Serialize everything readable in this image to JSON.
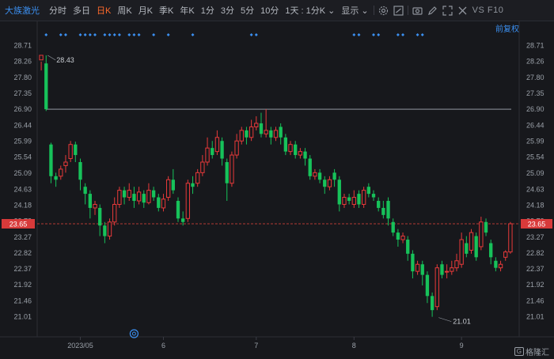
{
  "toolbar": {
    "stock_name": "大族激光",
    "tabs": [
      "分时",
      "多日",
      "日K",
      "周K",
      "月K",
      "季K",
      "年K",
      "1分",
      "3分",
      "5分",
      "10分",
      "1天 : 1分K ⌄",
      "显示 ⌄"
    ],
    "active_tab": "日K",
    "vs_f10": "VS F10",
    "icons": [
      "gear-icon",
      "compare-icon",
      "camera-icon",
      "edit-icon",
      "expand-icon",
      "close-icon"
    ]
  },
  "adjust_label": "前复权",
  "colors": {
    "up": "#e83a3a",
    "down": "#17c25a",
    "price_line": "#e8463c",
    "accent": "#3b8ff0",
    "price_tag_bg": "#d83a3a"
  },
  "chart_data": {
    "type": "candlestick",
    "ylim": [
      20.8,
      28.9
    ],
    "y_ticks": [
      "28.71",
      "28.26",
      "27.80",
      "27.35",
      "26.90",
      "26.44",
      "25.99",
      "25.54",
      "25.09",
      "24.63",
      "24.18",
      "23.73",
      "23.27",
      "22.82",
      "22.37",
      "21.92",
      "21.46",
      "21.01"
    ],
    "current_price": "23.65",
    "hline_value": 26.9,
    "x_labels": [
      {
        "index": 8,
        "label": "2023/05"
      },
      {
        "index": 25,
        "label": "6"
      },
      {
        "index": 44,
        "label": "7"
      },
      {
        "index": 64,
        "label": "8"
      },
      {
        "index": 86,
        "label": "9"
      }
    ],
    "annotations": [
      {
        "index": 1,
        "value": 28.43,
        "label": "28.43"
      },
      {
        "index": 81,
        "value": 21.01,
        "label": "21.01"
      }
    ],
    "dividend_markers": [
      1,
      4,
      5,
      8,
      9,
      10,
      11,
      13,
      14,
      15,
      16,
      18,
      19,
      20,
      23,
      26,
      31,
      43,
      44,
      64,
      65,
      68,
      69,
      73,
      74,
      77,
      78
    ],
    "event_marker_index": 19,
    "candles": [
      [
        28.3,
        28.43,
        28.25,
        28.0
      ],
      [
        28.2,
        26.9,
        28.43,
        26.85
      ],
      [
        25.9,
        25.0,
        25.95,
        24.8
      ],
      [
        25.0,
        24.9,
        25.1,
        24.7
      ],
      [
        25.0,
        25.2,
        25.3,
        24.9
      ],
      [
        25.3,
        25.4,
        25.6,
        25.1
      ],
      [
        25.5,
        25.9,
        26.0,
        25.4
      ],
      [
        25.9,
        25.6,
        25.98,
        25.4
      ],
      [
        25.4,
        24.9,
        25.5,
        24.6
      ],
      [
        24.7,
        24.5,
        24.8,
        24.2
      ],
      [
        24.5,
        24.1,
        24.6,
        23.8
      ],
      [
        24.1,
        24.2,
        24.3,
        23.9
      ],
      [
        24.1,
        23.6,
        24.2,
        23.3
      ],
      [
        23.6,
        23.3,
        23.7,
        23.1
      ],
      [
        23.3,
        23.7,
        23.8,
        23.2
      ],
      [
        23.7,
        24.2,
        24.4,
        23.6
      ],
      [
        24.2,
        24.6,
        24.7,
        24.1
      ],
      [
        24.6,
        24.4,
        24.7,
        24.2
      ],
      [
        24.4,
        24.6,
        24.8,
        24.3
      ],
      [
        24.5,
        24.3,
        24.7,
        24.1
      ],
      [
        24.3,
        24.55,
        24.7,
        24.2
      ],
      [
        24.5,
        24.25,
        24.6,
        24.1
      ],
      [
        24.25,
        24.6,
        24.8,
        24.2
      ],
      [
        24.6,
        24.4,
        24.7,
        24.3
      ],
      [
        24.4,
        24.1,
        24.5,
        24.0
      ],
      [
        24.1,
        24.35,
        24.5,
        24.0
      ],
      [
        24.4,
        24.9,
        25.0,
        24.3
      ],
      [
        24.9,
        24.6,
        25.2,
        24.5
      ],
      [
        24.3,
        23.8,
        24.4,
        23.7
      ],
      [
        23.8,
        23.7,
        24.0,
        23.6
      ],
      [
        23.8,
        24.8,
        24.9,
        23.7
      ],
      [
        24.8,
        24.7,
        25.0,
        24.5
      ],
      [
        24.8,
        25.1,
        25.2,
        24.7
      ],
      [
        25.1,
        25.4,
        25.6,
        25.0
      ],
      [
        25.4,
        25.8,
        26.1,
        25.3
      ],
      [
        25.8,
        25.6,
        26.0,
        25.5
      ],
      [
        25.7,
        26.1,
        26.3,
        25.6
      ],
      [
        26.0,
        25.5,
        26.1,
        25.3
      ],
      [
        25.4,
        24.8,
        25.5,
        24.3
      ],
      [
        24.8,
        25.6,
        25.7,
        24.7
      ],
      [
        25.6,
        26.0,
        26.2,
        25.5
      ],
      [
        26.0,
        26.3,
        26.4,
        25.9
      ],
      [
        26.3,
        26.1,
        26.4,
        25.9
      ],
      [
        26.1,
        26.4,
        26.6,
        26.0
      ],
      [
        26.4,
        26.5,
        26.7,
        26.3
      ],
      [
        26.5,
        26.2,
        26.8,
        26.1
      ],
      [
        26.2,
        26.3,
        26.9,
        26.1
      ],
      [
        26.3,
        26.1,
        26.4,
        25.9
      ],
      [
        26.1,
        26.3,
        26.4,
        26.0
      ],
      [
        26.4,
        26.1,
        26.5,
        25.9
      ],
      [
        26.1,
        25.7,
        26.2,
        25.6
      ],
      [
        25.7,
        25.9,
        26.0,
        25.6
      ],
      [
        25.9,
        25.6,
        26.0,
        25.5
      ],
      [
        25.6,
        25.7,
        25.8,
        25.5
      ],
      [
        25.7,
        25.5,
        25.8,
        25.3
      ],
      [
        25.5,
        25.0,
        25.6,
        24.9
      ],
      [
        25.0,
        25.1,
        25.2,
        24.9
      ],
      [
        25.1,
        24.9,
        25.2,
        24.8
      ],
      [
        24.9,
        24.7,
        25.0,
        24.5
      ],
      [
        24.7,
        24.9,
        25.0,
        24.6
      ],
      [
        25.1,
        24.9,
        25.2,
        24.7
      ],
      [
        24.9,
        24.2,
        25.0,
        24.0
      ],
      [
        24.2,
        24.4,
        24.5,
        24.1
      ],
      [
        24.4,
        24.3,
        24.5,
        24.2
      ],
      [
        24.2,
        24.4,
        24.6,
        24.1
      ],
      [
        24.5,
        24.2,
        24.6,
        24.1
      ],
      [
        24.2,
        24.6,
        24.7,
        24.1
      ],
      [
        24.7,
        24.5,
        24.8,
        24.4
      ],
      [
        24.5,
        24.4,
        24.6,
        24.3
      ],
      [
        24.3,
        24.1,
        24.4,
        24.0
      ],
      [
        24.1,
        23.9,
        24.3,
        23.8
      ],
      [
        24.3,
        23.8,
        24.4,
        23.6
      ],
      [
        23.7,
        23.4,
        23.8,
        23.3
      ],
      [
        23.4,
        23.2,
        23.5,
        23.0
      ],
      [
        23.2,
        23.3,
        23.4,
        23.1
      ],
      [
        23.2,
        22.8,
        23.3,
        22.6
      ],
      [
        22.8,
        22.3,
        22.9,
        22.1
      ],
      [
        22.3,
        22.5,
        22.6,
        22.2
      ],
      [
        22.5,
        22.2,
        22.6,
        21.9
      ],
      [
        22.2,
        21.6,
        22.3,
        21.4
      ],
      [
        21.6,
        21.2,
        21.7,
        21.01
      ],
      [
        21.3,
        22.4,
        22.5,
        21.2
      ],
      [
        22.5,
        22.2,
        22.6,
        22.1
      ],
      [
        22.3,
        22.3,
        22.5,
        22.1
      ],
      [
        22.3,
        22.4,
        22.6,
        22.2
      ],
      [
        22.4,
        22.6,
        22.8,
        22.3
      ],
      [
        22.5,
        23.2,
        23.4,
        22.4
      ],
      [
        23.1,
        22.8,
        23.3,
        22.7
      ],
      [
        22.9,
        23.4,
        23.5,
        22.8
      ],
      [
        23.3,
        22.7,
        23.4,
        22.6
      ],
      [
        23.0,
        23.7,
        23.85,
        22.9
      ],
      [
        23.7,
        23.4,
        23.8,
        23.3
      ],
      [
        23.1,
        22.7,
        23.2,
        22.5
      ],
      [
        22.6,
        22.4,
        22.7,
        22.3
      ],
      [
        22.4,
        22.5,
        22.6,
        22.3
      ],
      [
        22.7,
        22.85,
        22.9,
        22.6
      ],
      [
        22.85,
        23.65,
        23.7,
        22.8
      ]
    ]
  },
  "watermark": {
    "logo": "G",
    "text": "格隆汇"
  }
}
